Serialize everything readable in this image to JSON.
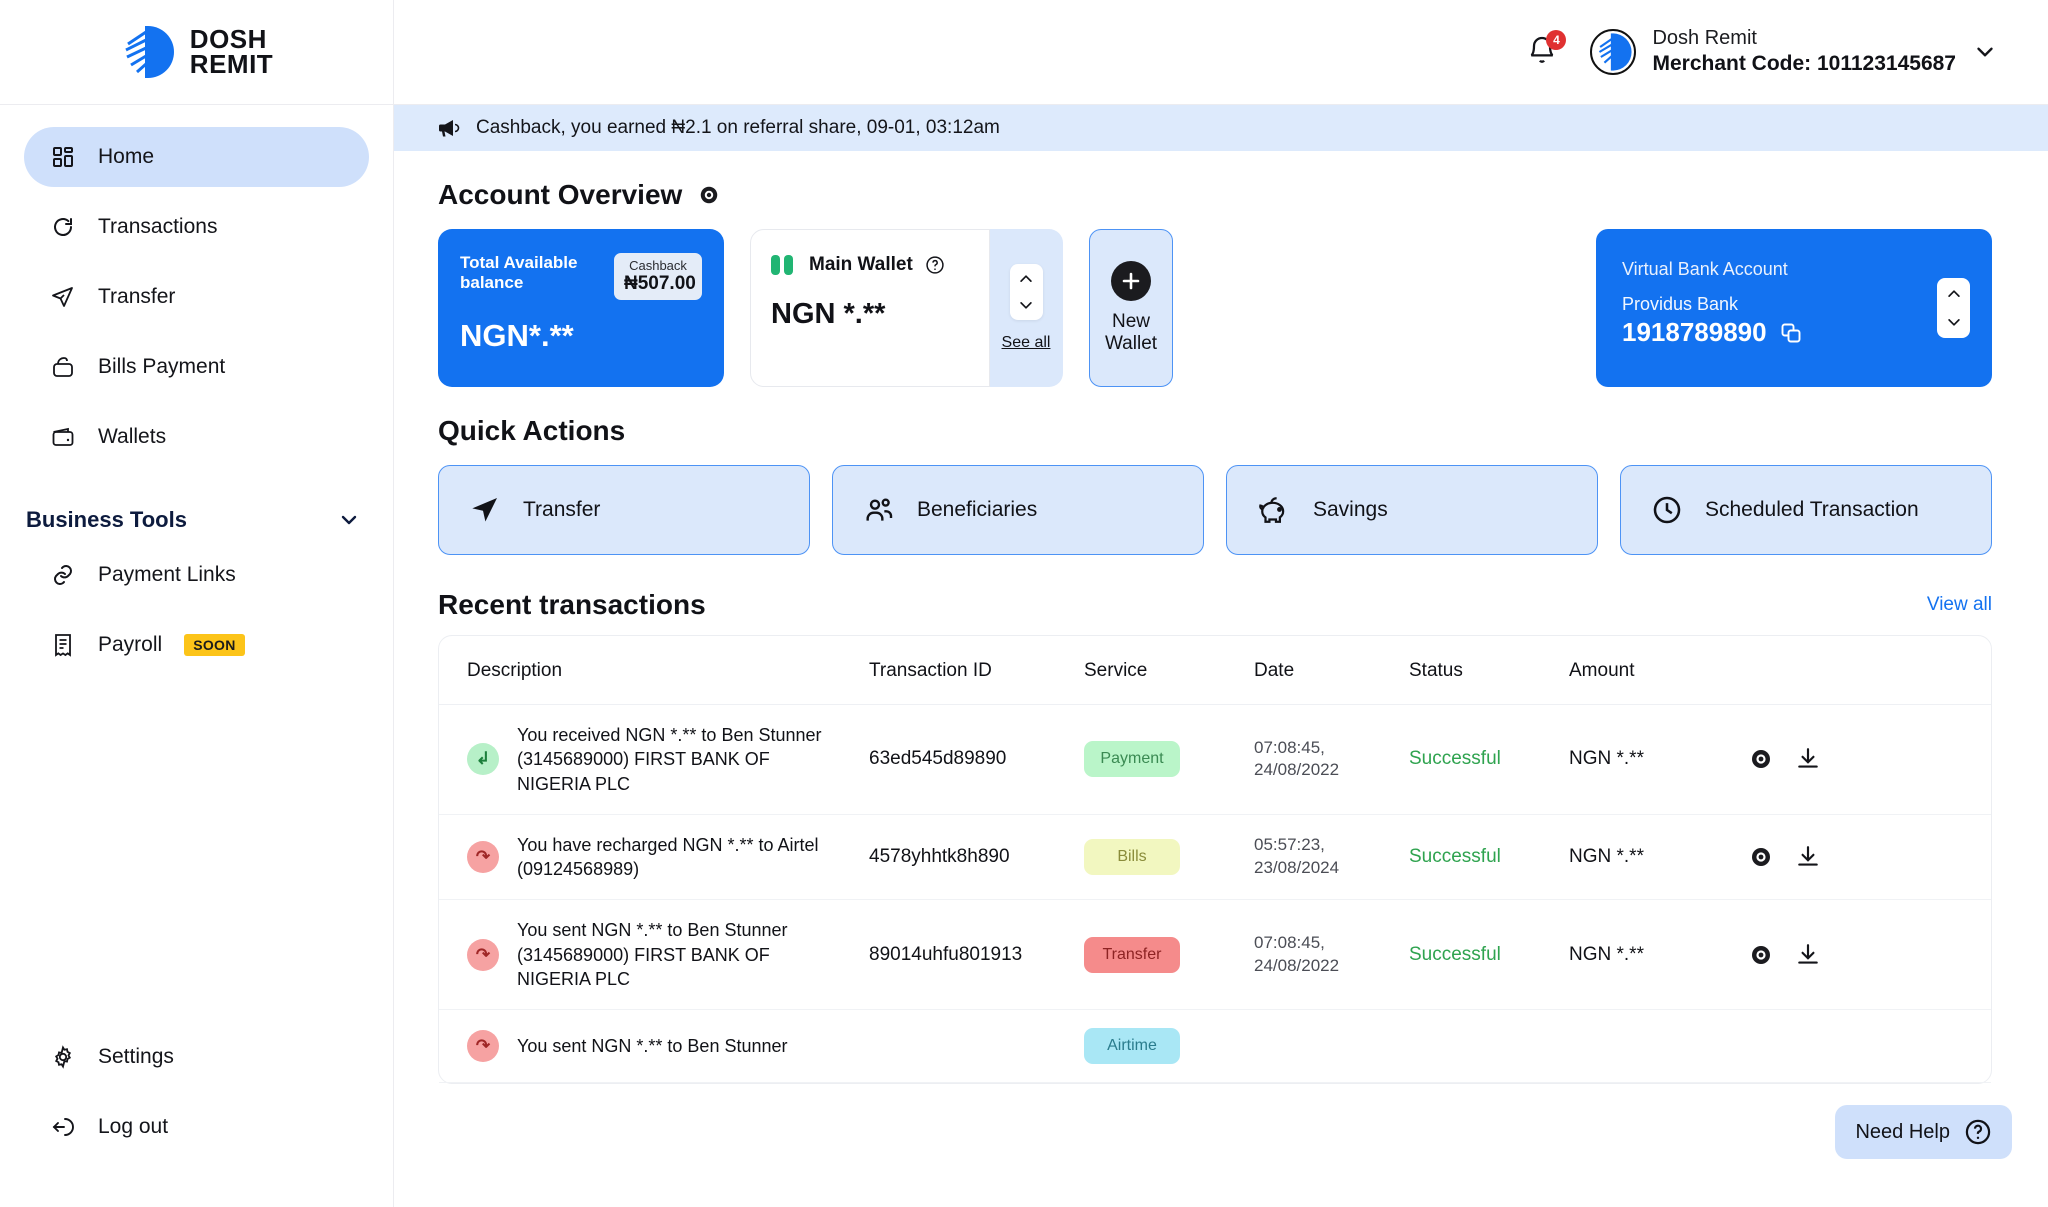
{
  "brand": {
    "line1": "DOSH",
    "line2": "REMIT"
  },
  "sidebar": {
    "items": [
      {
        "label": "Home",
        "icon": "grid-icon",
        "active": true
      },
      {
        "label": "Transactions",
        "icon": "refresh-icon",
        "active": false
      },
      {
        "label": "Transfer",
        "icon": "send-icon",
        "active": false
      },
      {
        "label": "Bills Payment",
        "icon": "bag-icon",
        "active": false
      },
      {
        "label": "Wallets",
        "icon": "wallet-icon",
        "active": false
      }
    ],
    "business_tools": {
      "title": "Business Tools",
      "chevron": "chevron-down-icon"
    },
    "tools": [
      {
        "label": "Payment Links",
        "icon": "link-icon",
        "badge": ""
      },
      {
        "label": "Payroll",
        "icon": "receipt-icon",
        "badge": "SOON"
      }
    ],
    "bottom": [
      {
        "label": "Settings",
        "icon": "gear-icon"
      },
      {
        "label": "Log out",
        "icon": "logout-icon"
      }
    ]
  },
  "topbar": {
    "notification_count": "4",
    "profile_name": "Dosh Remit",
    "merchant_code": "Merchant Code: 101123145687"
  },
  "banner": {
    "text": "Cashback, you earned ₦2.1 on referral share, 09-01, 03:12am"
  },
  "account_overview": {
    "title": "Account Overview",
    "eye_icon": "eye-icon",
    "balance_card": {
      "label": "Total Available balance",
      "cashback_label": "Cashback",
      "cashback_value": "₦507.00",
      "amount": "NGN*.**"
    },
    "wallet_card": {
      "name": "Main Wallet",
      "amount": "NGN *.**",
      "see_all": "See all"
    },
    "new_wallet": {
      "label": "New Wallet"
    },
    "virtual_bank": {
      "label": "Virtual Bank Account",
      "bank": "Providus Bank",
      "account_number": "1918789890"
    }
  },
  "quick_actions": {
    "title": "Quick Actions",
    "items": [
      {
        "label": "Transfer",
        "icon": "send-icon"
      },
      {
        "label": "Beneficiaries",
        "icon": "people-icon"
      },
      {
        "label": "Savings",
        "icon": "piggy-bank-icon"
      },
      {
        "label": "Scheduled Transaction",
        "icon": "clock-icon"
      }
    ]
  },
  "recent_transactions": {
    "title": "Recent transactions",
    "view_all": "View all",
    "columns": [
      "Description",
      "Transaction ID",
      "Service",
      "Date",
      "Status",
      "Amount"
    ],
    "rows": [
      {
        "direction": "in",
        "description": "You received  NGN *.** to Ben Stunner (3145689000) FIRST BANK OF NIGERIA PLC",
        "transaction_id": "63ed545d89890",
        "service": "Payment",
        "service_type": "payment",
        "time": "07:08:45,",
        "date": "24/08/2022",
        "status": "Successful",
        "amount": "NGN *.**"
      },
      {
        "direction": "out",
        "description": "You have recharged NGN *.** to Airtel (09124568989)",
        "transaction_id": "4578yhhtk8h890",
        "service": "Bills",
        "service_type": "bills",
        "time": "05:57:23,",
        "date": "23/08/2024",
        "status": "Successful",
        "amount": "NGN *.**"
      },
      {
        "direction": "out",
        "description": "You sent NGN *.** to Ben Stunner (3145689000) FIRST BANK OF NIGERIA PLC",
        "transaction_id": "89014uhfu801913",
        "service": "Transfer",
        "service_type": "transfer",
        "time": "07:08:45,",
        "date": "24/08/2022",
        "status": "Successful",
        "amount": "NGN *.**"
      },
      {
        "direction": "out",
        "description": "You sent NGN *.** to Ben Stunner",
        "transaction_id": "",
        "service": "Airtime",
        "service_type": "airtime",
        "time": "",
        "date": "",
        "status": "",
        "amount": ""
      }
    ]
  },
  "need_help": {
    "label": "Need Help",
    "icon": "question-circle-icon"
  },
  "colors": {
    "brand_blue": "#1372f0",
    "light_blue": "#dbe8fb",
    "banner_blue": "#ddeafc",
    "success_green": "#2fa34f",
    "soon_yellow": "#fcc419",
    "alert_red": "#e03131"
  }
}
